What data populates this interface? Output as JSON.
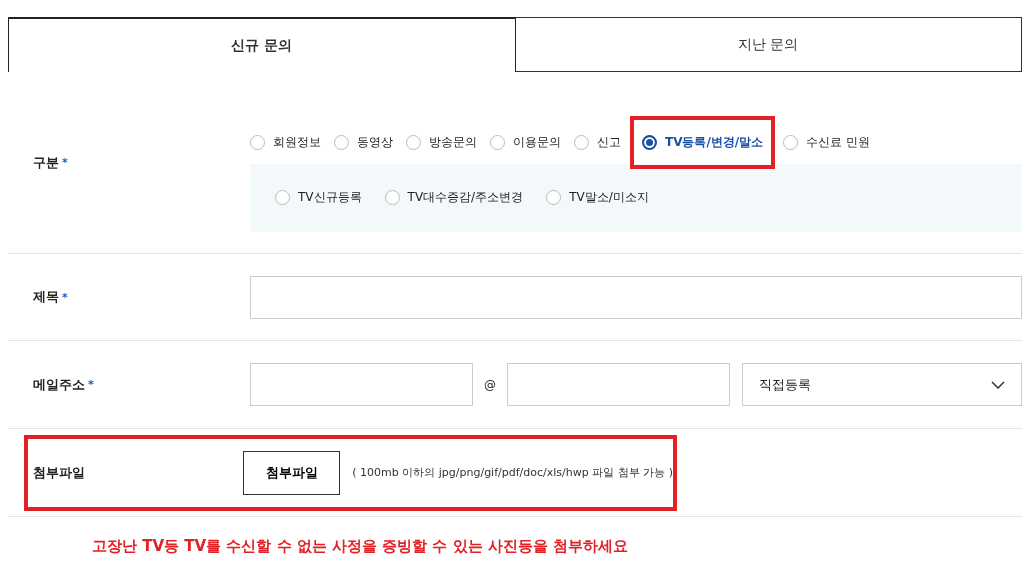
{
  "tabs": [
    {
      "label": "신규 문의",
      "selected": true
    },
    {
      "label": "지난 문의",
      "selected": false
    }
  ],
  "category": {
    "label": "구분",
    "required_mark": "*",
    "options": [
      {
        "label": "회원정보",
        "selected": false,
        "highlighted": false
      },
      {
        "label": "동영상",
        "selected": false,
        "highlighted": false
      },
      {
        "label": "방송문의",
        "selected": false,
        "highlighted": false
      },
      {
        "label": "이용문의",
        "selected": false,
        "highlighted": false
      },
      {
        "label": "신고",
        "selected": false,
        "highlighted": false
      },
      {
        "label": "TV등록/변경/말소",
        "selected": true,
        "highlighted": true
      },
      {
        "label": "수신료 민원",
        "selected": false,
        "highlighted": false
      }
    ],
    "sub_options": [
      {
        "label": "TV신규등록",
        "selected": false
      },
      {
        "label": "TV대수증감/주소변경",
        "selected": false
      },
      {
        "label": "TV말소/미소지",
        "selected": false
      }
    ]
  },
  "subject": {
    "label": "제목",
    "required_mark": "*"
  },
  "email": {
    "label": "메일주소",
    "required_mark": "*",
    "at": "@",
    "domain_select": "직접등록"
  },
  "attachment": {
    "label": "첨부파일",
    "button": "첨부파일",
    "hint": "( 100mb 이하의 jpg/png/gif/pdf/doc/xls/hwp 파일 첨부 가능 )",
    "highlighted": true
  },
  "notice": "고장난 TV등 TV를 수신할 수 없는 사정을 증빙할 수 있는 사진등을 첨부하세요"
}
